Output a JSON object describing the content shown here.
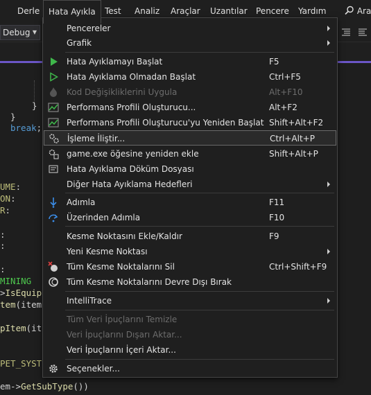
{
  "menubar": {
    "items": [
      {
        "label": "Derle"
      },
      {
        "label": "Hata Ayıkla"
      },
      {
        "label": "Test"
      },
      {
        "label": "Analiz"
      },
      {
        "label": "Araçlar"
      },
      {
        "label": "Uzantılar"
      },
      {
        "label": "Pencere"
      },
      {
        "label": "Yardım"
      }
    ],
    "search_label": "Ara"
  },
  "toolbar": {
    "configuration": "Debug"
  },
  "menu": {
    "items": [
      {
        "label": "Pencereler",
        "shortcut": "",
        "submenu": true,
        "enabled": true,
        "icon": ""
      },
      {
        "label": "Grafik",
        "shortcut": "",
        "submenu": true,
        "enabled": true,
        "icon": ""
      },
      {
        "label": "Hata Ayıklamayı Başlat",
        "shortcut": "F5",
        "submenu": false,
        "enabled": true,
        "icon": "play-icon"
      },
      {
        "label": "Hata Ayıklama Olmadan Başlat",
        "shortcut": "Ctrl+F5",
        "submenu": false,
        "enabled": true,
        "icon": "play-outline-icon"
      },
      {
        "label": "Kod Değişikliklerini Uygula",
        "shortcut": "Alt+F10",
        "submenu": false,
        "enabled": false,
        "icon": "flame-icon"
      },
      {
        "label": "Performans Profili Oluşturucu...",
        "shortcut": "Alt+F2",
        "submenu": false,
        "enabled": true,
        "icon": "performance-chart-icon"
      },
      {
        "label": "Performans Profili Oluşturucu'yu Yeniden Başlat",
        "shortcut": "Shift+Alt+F2",
        "submenu": false,
        "enabled": true,
        "icon": "performance-restart-icon"
      },
      {
        "label": "İşleme İliştir...",
        "shortcut": "Ctrl+Alt+P",
        "submenu": false,
        "enabled": true,
        "icon": "gears-icon"
      },
      {
        "label": "game.exe öğesine yeniden ekle",
        "shortcut": "Shift+Alt+P",
        "submenu": false,
        "enabled": true,
        "icon": "gear-reattach-icon"
      },
      {
        "label": "Hata Ayıklama Döküm Dosyası",
        "shortcut": "",
        "submenu": false,
        "enabled": true,
        "icon": "dump-file-icon"
      },
      {
        "label": "Diğer Hata Ayıklama Hedefleri",
        "shortcut": "",
        "submenu": true,
        "enabled": true,
        "icon": ""
      },
      {
        "label": "Adımla",
        "shortcut": "F11",
        "submenu": false,
        "enabled": true,
        "icon": "step-into-icon"
      },
      {
        "label": "Üzerinden Adımla",
        "shortcut": "F10",
        "submenu": false,
        "enabled": true,
        "icon": "step-over-icon"
      },
      {
        "label": "Kesme Noktasını Ekle/Kaldır",
        "shortcut": "F9",
        "submenu": false,
        "enabled": true,
        "icon": ""
      },
      {
        "label": "Yeni Kesme Noktası",
        "shortcut": "",
        "submenu": true,
        "enabled": true,
        "icon": ""
      },
      {
        "label": "Tüm Kesme Noktalarını Sil",
        "shortcut": "Ctrl+Shift+F9",
        "submenu": false,
        "enabled": true,
        "icon": "delete-breakpoints-icon"
      },
      {
        "label": "Tüm Kesme Noktalarını Devre Dışı Bırak",
        "shortcut": "",
        "submenu": false,
        "enabled": true,
        "icon": "disable-breakpoints-icon"
      },
      {
        "label": "IntelliTrace",
        "shortcut": "",
        "submenu": true,
        "enabled": true,
        "icon": ""
      },
      {
        "label": "Tüm Veri İpuçlarını Temizle",
        "shortcut": "",
        "submenu": false,
        "enabled": false,
        "icon": ""
      },
      {
        "label": "Veri İpuçlarını Dışarı Aktar...",
        "shortcut": "",
        "submenu": false,
        "enabled": false,
        "icon": ""
      },
      {
        "label": "Veri İpuçlarını İçeri Aktar...",
        "shortcut": "",
        "submenu": false,
        "enabled": true,
        "icon": ""
      },
      {
        "label": "Seçenekler...",
        "shortcut": "",
        "submenu": false,
        "enabled": true,
        "icon": "settings-gear-icon"
      }
    ]
  },
  "editor": {
    "lines": [
      {
        "segments": [
          {
            "text": "}",
            "cls": "punc"
          }
        ]
      },
      {
        "segments": [
          {
            "text": "}",
            "cls": "punc"
          }
        ]
      },
      {
        "segments": [
          {
            "text": "break",
            "cls": "kw"
          },
          {
            "text": ";",
            "cls": "punc"
          }
        ]
      },
      {
        "segments": [
          {
            "text": "UME",
            "cls": "const"
          },
          {
            "text": ":",
            "cls": "punc"
          }
        ]
      },
      {
        "segments": [
          {
            "text": "ON",
            "cls": "const"
          },
          {
            "text": ":",
            "cls": "punc"
          }
        ]
      },
      {
        "segments": [
          {
            "text": "R",
            "cls": "const"
          },
          {
            "text": ":",
            "cls": "punc"
          }
        ]
      },
      {
        "segments": [
          {
            "text": ":",
            "cls": "punc"
          }
        ]
      },
      {
        "segments": [
          {
            "text": ":",
            "cls": "punc"
          }
        ]
      },
      {
        "segments": [
          {
            "text": ":",
            "cls": "punc"
          }
        ]
      },
      {
        "segments": [
          {
            "text": "MINING",
            "cls": "green"
          }
        ]
      },
      {
        "segments": [
          {
            "text": ">",
            "cls": "punc"
          },
          {
            "text": "IsEquip",
            "cls": "fn"
          }
        ]
      },
      {
        "segments": [
          {
            "text": "tem",
            "cls": "fn"
          },
          {
            "text": "(item",
            "cls": "punc"
          }
        ]
      },
      {
        "segments": [
          {
            "text": "pItem",
            "cls": "fn"
          },
          {
            "text": "(it",
            "cls": "punc"
          }
        ]
      },
      {
        "segments": [
          {
            "text": "PET_SYST",
            "cls": "const"
          }
        ]
      },
      {
        "segments": [
          {
            "text": "em->",
            "cls": "punc"
          },
          {
            "text": "GetSubType",
            "cls": "fn"
          },
          {
            "text": "())",
            "cls": "punc"
          }
        ]
      }
    ]
  }
}
